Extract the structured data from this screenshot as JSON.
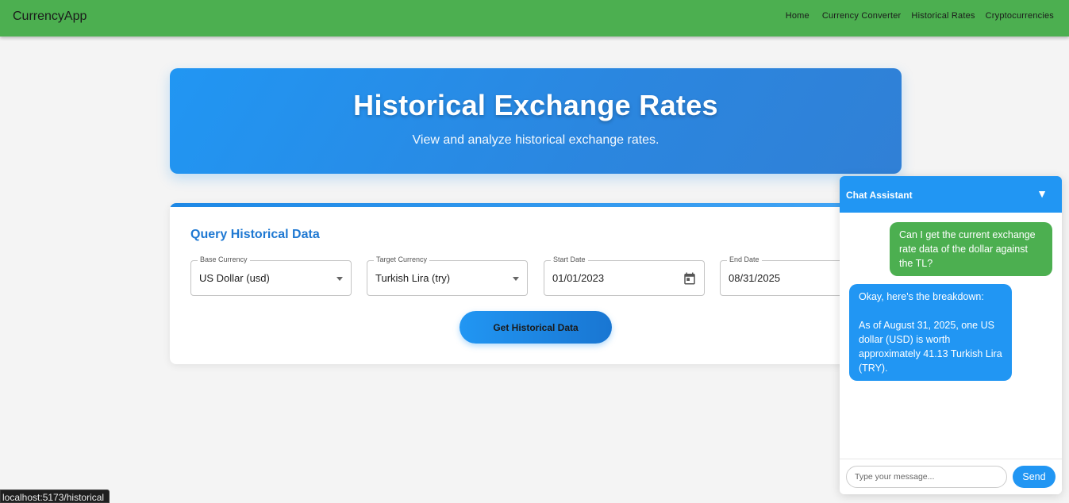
{
  "navbar": {
    "brand": "CurrencyApp",
    "links": [
      "Home",
      "Currency Converter",
      "Historical Rates",
      "Cryptocurrencies"
    ],
    "background": "#4caf50"
  },
  "hero": {
    "title": "Historical Exchange Rates",
    "subtitle": "View and analyze historical exchange rates."
  },
  "query": {
    "title": "Query Historical Data",
    "fields": [
      {
        "label": "Base Currency",
        "value": "US Dollar (usd)",
        "kind": "select",
        "icon": "chevron-down-icon"
      },
      {
        "label": "Target Currency",
        "value": "Turkish Lira (try)",
        "kind": "select",
        "icon": "chevron-down-icon"
      },
      {
        "label": "Start Date",
        "value": "01/01/2023",
        "kind": "date",
        "icon": "calendar-icon"
      },
      {
        "label": "End Date",
        "value": "08/31/2025",
        "kind": "date",
        "icon": "calendar-icon"
      }
    ],
    "button_label": "Get Historical Data"
  },
  "chat": {
    "title": "Chat Assistant",
    "toggle_symbol": "▼",
    "messages": [
      {
        "role": "user",
        "text": "Can I get the current exchange rate data of the dollar against the TL?"
      },
      {
        "role": "assistant",
        "text": "Okay, here's the breakdown:\n\nAs of August 31, 2025, one US dollar (USD) is worth approximately 41.13 Turkish Lira (TRY)."
      }
    ],
    "input_placeholder": "Type your message...",
    "send_label": "Send"
  },
  "status_bar": {
    "url": "localhost:5173/historical"
  },
  "colors": {
    "accent": "#2196f3",
    "title_blue": "#1e78d2",
    "user_bubble": "#4caf50"
  }
}
